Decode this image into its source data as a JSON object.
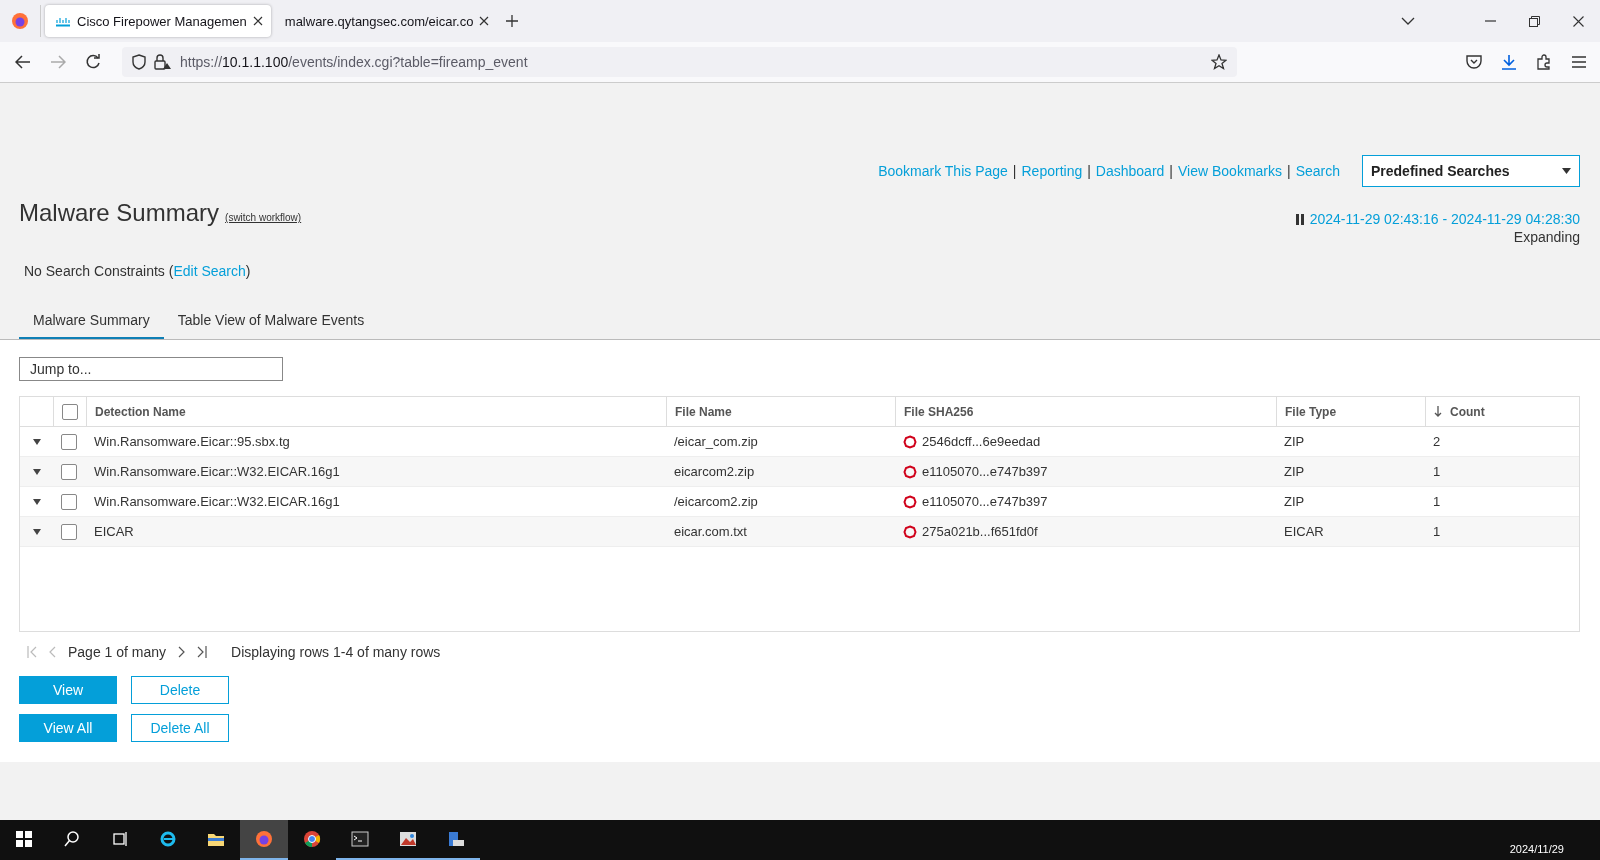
{
  "browser": {
    "tabs": [
      {
        "title": "Cisco Firepower Managemen",
        "selected": true,
        "kind": "cisco"
      },
      {
        "title": "malware.qytangsec.com/eicar.co",
        "selected": false,
        "kind": "plain"
      }
    ],
    "url": {
      "scheme": "https://",
      "host": "10.1.1.100",
      "path": "/events/index.cgi?table=fireamp_event"
    }
  },
  "header": {
    "links": [
      "Bookmark This Page",
      "Reporting",
      "Dashboard",
      "View Bookmarks",
      "Search"
    ],
    "separator": "|",
    "predefined_searches": "Predefined Searches"
  },
  "page": {
    "title": "Malware Summary",
    "switch_workflow": "(switch workflow)",
    "time_range": "2024-11-29 02:43:16 - 2024-11-29 04:28:30",
    "time_status": "Expanding",
    "constraints": {
      "before": "No Search Constraints (",
      "link": "Edit Search",
      "after": ")"
    },
    "tabs": [
      {
        "label": "Malware Summary",
        "selected": true
      },
      {
        "label": "Table View of Malware Events",
        "selected": false
      }
    ],
    "jump_to": {
      "placeholder": "Jump to..."
    }
  },
  "table": {
    "all_checked": false,
    "columns": [
      {
        "label": "Detection Name",
        "sorted": false
      },
      {
        "label": "File Name",
        "sorted": false
      },
      {
        "label": "File SHA256",
        "sorted": false
      },
      {
        "label": "File Type",
        "sorted": false
      },
      {
        "label": "Count",
        "sorted": true
      }
    ],
    "rows": [
      {
        "detection": "Win.Ransomware.Eicar::95.sbx.tg",
        "file_name": "/eicar_com.zip",
        "sha256": "2546dcff...6e9eedad",
        "file_type": "ZIP",
        "count": "2",
        "checked": false
      },
      {
        "detection": "Win.Ransomware.Eicar::W32.EICAR.16g1",
        "file_name": "eicarcom2.zip",
        "sha256": "e1105070...e747b397",
        "file_type": "ZIP",
        "count": "1",
        "checked": false
      },
      {
        "detection": "Win.Ransomware.Eicar::W32.EICAR.16g1",
        "file_name": "/eicarcom2.zip",
        "sha256": "e1105070...e747b397",
        "file_type": "ZIP",
        "count": "1",
        "checked": false
      },
      {
        "detection": "EICAR",
        "file_name": "eicar.com.txt",
        "sha256": "275a021b...f651fd0f",
        "file_type": "EICAR",
        "count": "1",
        "checked": false
      }
    ]
  },
  "pager": {
    "page": "Page 1 of many",
    "displaying": "Displaying rows 1-4 of many rows",
    "first_disabled": true,
    "prev_disabled": true,
    "next_disabled": false,
    "last_disabled": false
  },
  "buttons": [
    [
      {
        "label": "View",
        "kind": "primary"
      },
      {
        "label": "Delete",
        "kind": "secondary"
      }
    ],
    [
      {
        "label": "View All",
        "kind": "primary"
      },
      {
        "label": "Delete All",
        "kind": "secondary"
      }
    ]
  ],
  "taskbar": {
    "items": [
      {
        "kind": "start",
        "selected": false,
        "running": false
      },
      {
        "kind": "search",
        "selected": false,
        "running": false
      },
      {
        "kind": "taskview",
        "selected": false,
        "running": false
      },
      {
        "kind": "ie",
        "selected": false,
        "running": false
      },
      {
        "kind": "explorer",
        "selected": false,
        "running": false
      },
      {
        "kind": "firefox",
        "selected": true,
        "running": true
      },
      {
        "kind": "chrome",
        "selected": false,
        "running": false
      },
      {
        "kind": "terminal",
        "selected": false,
        "running": true
      },
      {
        "kind": "image",
        "selected": false,
        "running": true
      },
      {
        "kind": "server",
        "selected": false,
        "running": true
      }
    ],
    "date": "2024/11/29"
  }
}
